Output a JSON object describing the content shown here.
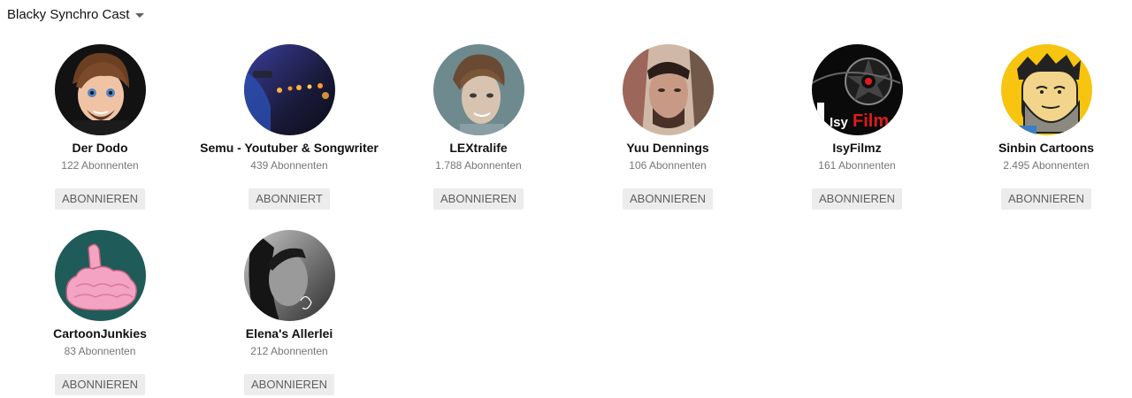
{
  "header": {
    "title": "Blacky Synchro Cast"
  },
  "channels": [
    {
      "name": "Der Dodo",
      "subscribers": "122 Abonnenten",
      "button": "ABONNIEREN"
    },
    {
      "name": "Semu - Youtuber & Songwriter",
      "subscribers": "439 Abonnenten",
      "button": "ABONNIERT"
    },
    {
      "name": "LEXtralife",
      "subscribers": "1.788 Abonnenten",
      "button": "ABONNIEREN"
    },
    {
      "name": "Yuu Dennings",
      "subscribers": "106 Abonnenten",
      "button": "ABONNIEREN"
    },
    {
      "name": "IsyFilmz",
      "subscribers": "161 Abonnenten",
      "button": "ABONNIEREN",
      "logo_text_1": "Isy",
      "logo_text_2": "Film"
    },
    {
      "name": "Sinbin Cartoons",
      "subscribers": "2.495 Abonnenten",
      "button": "ABONNIEREN"
    },
    {
      "name": "CartoonJunkies",
      "subscribers": "83 Abonnenten",
      "button": "ABONNIEREN"
    },
    {
      "name": "Elena's Allerlei",
      "subscribers": "212 Abonnenten",
      "button": "ABONNIEREN"
    }
  ],
  "colors": {
    "button_bg": "#ececec",
    "button_text": "#5f5f5f",
    "subs_text": "#767676"
  }
}
